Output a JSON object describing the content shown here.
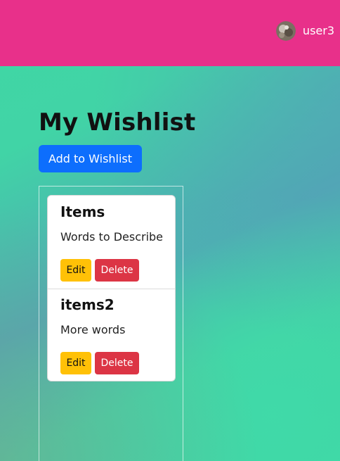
{
  "nav": {
    "username": "user3",
    "avatar_icon": "user-avatar-icon",
    "background_color": "#e8308a"
  },
  "main": {
    "title": "My Wishlist",
    "add_button_label": "Add to Wishlist"
  },
  "wishlist": {
    "items": [
      {
        "title": "Items",
        "description": "Words to Describe",
        "edit_label": "Edit",
        "delete_label": "Delete"
      },
      {
        "title": "items2",
        "description": "More words",
        "edit_label": "Edit",
        "delete_label": "Delete"
      }
    ]
  },
  "colors": {
    "primary": "#0d6efd",
    "warning": "#ffc107",
    "danger": "#dc3545",
    "gradient_green": "#40d7a4",
    "gradient_teal": "#50a8b4"
  }
}
